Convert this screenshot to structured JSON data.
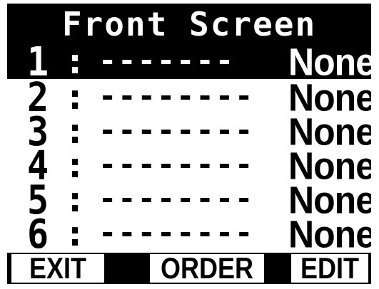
{
  "screen": {
    "title": "Front Screen"
  },
  "slots": [
    {
      "number": "1",
      "colon": ":",
      "dashes": "-------",
      "value": "None",
      "selected": true
    },
    {
      "number": "2",
      "colon": ":",
      "dashes": "--------",
      "value": "None",
      "selected": false
    },
    {
      "number": "3",
      "colon": ":",
      "dashes": "--------",
      "value": "None",
      "selected": false
    },
    {
      "number": "4",
      "colon": ":",
      "dashes": "--------",
      "value": "None",
      "selected": false
    },
    {
      "number": "5",
      "colon": ":",
      "dashes": "--------",
      "value": "None",
      "selected": false
    },
    {
      "number": "6",
      "colon": ":",
      "dashes": "--------",
      "value": "None",
      "selected": false
    }
  ],
  "softkeys": {
    "left_label": "EXIT",
    "center_label": "ORDER",
    "right_label": "EDIT"
  },
  "colors": {
    "background": "#000000",
    "foreground": "#ffffff",
    "highlight_bg": "#000000",
    "highlight_fg": "#ffffff"
  }
}
